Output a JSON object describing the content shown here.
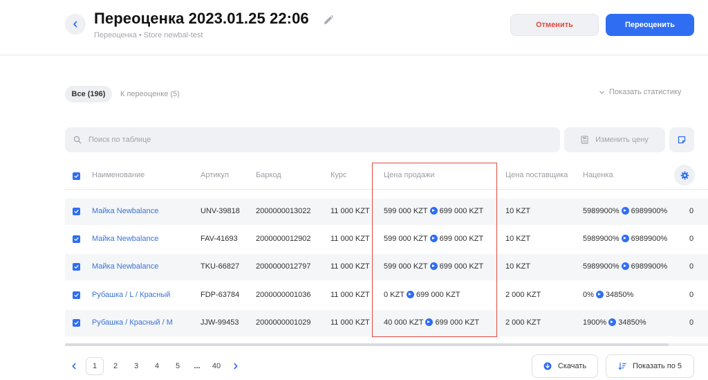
{
  "header": {
    "title": "Переоценка 2023.01.25 22:06",
    "breadcrumb": "Переоценка • Store newbal-test",
    "cancel_label": "Отменить",
    "primary_label": "Переоценить"
  },
  "tabs": [
    {
      "label": "Все (196)",
      "active": true
    },
    {
      "label": "К переоценке (5)",
      "active": false
    }
  ],
  "stats_toggle_label": "Показать статистику",
  "search": {
    "placeholder": "Поиск по таблице",
    "value": ""
  },
  "change_price_label": "Изменить цену",
  "table": {
    "columns": [
      "Наименование",
      "Артикул",
      "Баркод",
      "Курс",
      "Цена продажи",
      "Цена поставщика",
      "Наценка"
    ],
    "rows": [
      {
        "checked": true,
        "name": "Майка Newbalance",
        "article": "UNV-39818",
        "barcode": "2000000013022",
        "rate": "11 000 KZT",
        "price_from": "599 000 KZT",
        "price_to": "699 000 KZT",
        "supplier_price": "10 KZT",
        "markup_from": "5989900%",
        "markup_to": "6989900%",
        "extra": "0"
      },
      {
        "checked": true,
        "name": "Майка Newbalance",
        "article": "FAV-41693",
        "barcode": "2000000012902",
        "rate": "11 000 KZT",
        "price_from": "599 000 KZT",
        "price_to": "699 000 KZT",
        "supplier_price": "10 KZT",
        "markup_from": "5989900%",
        "markup_to": "6989900%",
        "extra": "0"
      },
      {
        "checked": true,
        "name": "Майка Newbalance",
        "article": "TKU-66827",
        "barcode": "2000000012797",
        "rate": "11 000 KZT",
        "price_from": "599 000 KZT",
        "price_to": "699 000 KZT",
        "supplier_price": "10 KZT",
        "markup_from": "5989900%",
        "markup_to": "6989900%",
        "extra": "0"
      },
      {
        "checked": true,
        "name": "Рубашка / L / Красный",
        "article": "FDP-63784",
        "barcode": "2000000001036",
        "rate": "11 000 KZT",
        "price_from": "0 KZT",
        "price_to": "699 000 KZT",
        "supplier_price": "2 000 KZT",
        "markup_from": "0%",
        "markup_to": "34850%",
        "extra": "0"
      },
      {
        "checked": true,
        "name": "Рубашка / Красный / M",
        "article": "JJW-99453",
        "barcode": "2000000001029",
        "rate": "11 000 KZT",
        "price_from": "40 000 KZT",
        "price_to": "699 000 KZT",
        "supplier_price": "2 000 KZT",
        "markup_from": "1900%",
        "markup_to": "34850%",
        "extra": "0"
      }
    ]
  },
  "pagination": {
    "pages": [
      "1",
      "2",
      "3",
      "4",
      "5",
      "...",
      "40"
    ],
    "current": "1",
    "prev_icon": "chevron-left-icon",
    "next_icon": "chevron-right-icon"
  },
  "download_label": "Скачать",
  "page_size_label": "Показать по 5",
  "colors": {
    "accent": "#2f6ef3",
    "danger": "#e0493c",
    "link": "#3a73d6"
  }
}
